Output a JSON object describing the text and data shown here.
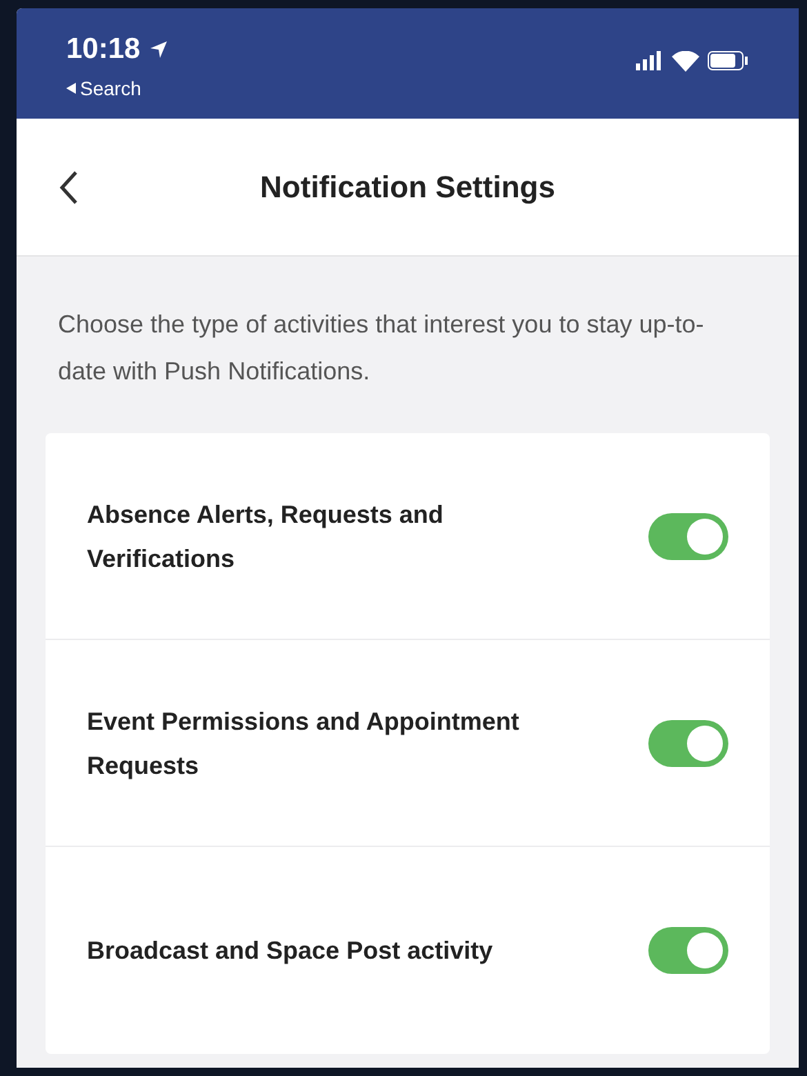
{
  "status_bar": {
    "time": "10:18",
    "back_label": "Search"
  },
  "nav": {
    "title": "Notification Settings"
  },
  "description": "Choose the type of activities that interest you to stay up-to-date with Push Notifications.",
  "settings": [
    {
      "label": "Absence Alerts, Requests and Verifications",
      "on": true
    },
    {
      "label": "Event Permissions and Appointment Requests",
      "on": true
    },
    {
      "label": "Broadcast and Space Post activity",
      "on": true
    }
  ]
}
